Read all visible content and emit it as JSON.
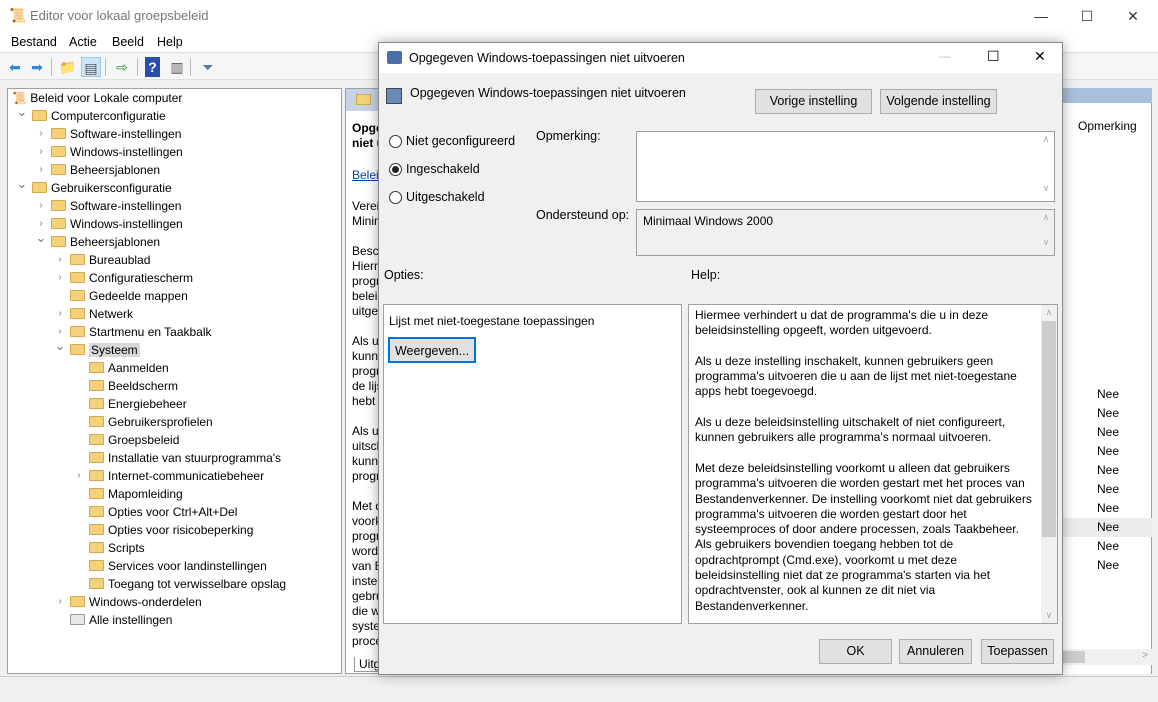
{
  "window": {
    "title": "Editor voor lokaal groepsbeleid",
    "minimize": "—",
    "maximize": "☐",
    "close": "✕"
  },
  "menu": [
    "Bestand",
    "Actie",
    "Beeld",
    "Help"
  ],
  "tree": {
    "root": "Beleid voor Lokale computer",
    "items": [
      {
        "label": "Computerconfiguratie",
        "level": 1,
        "exp": "open"
      },
      {
        "label": "Software-instellingen",
        "level": 2,
        "exp": "closed"
      },
      {
        "label": "Windows-instellingen",
        "level": 2,
        "exp": "closed"
      },
      {
        "label": "Beheersjablonen",
        "level": 2,
        "exp": "closed"
      },
      {
        "label": "Gebruikersconfiguratie",
        "level": 1,
        "exp": "open"
      },
      {
        "label": "Software-instellingen",
        "level": 2,
        "exp": "closed"
      },
      {
        "label": "Windows-instellingen",
        "level": 2,
        "exp": "closed"
      },
      {
        "label": "Beheersjablonen",
        "level": 2,
        "exp": "open"
      },
      {
        "label": "Bureaublad",
        "level": 3,
        "exp": "closed"
      },
      {
        "label": "Configuratiescherm",
        "level": 3,
        "exp": "closed"
      },
      {
        "label": "Gedeelde mappen",
        "level": 3,
        "exp": "none"
      },
      {
        "label": "Netwerk",
        "level": 3,
        "exp": "closed"
      },
      {
        "label": "Startmenu en Taakbalk",
        "level": 3,
        "exp": "closed"
      },
      {
        "label": "Systeem",
        "level": 3,
        "exp": "open",
        "selected": true
      },
      {
        "label": "Aanmelden",
        "level": 4,
        "exp": "none"
      },
      {
        "label": "Beeldscherm",
        "level": 4,
        "exp": "none"
      },
      {
        "label": "Energiebeheer",
        "level": 4,
        "exp": "none"
      },
      {
        "label": "Gebruikersprofielen",
        "level": 4,
        "exp": "none"
      },
      {
        "label": "Groepsbeleid",
        "level": 4,
        "exp": "none"
      },
      {
        "label": "Installatie van stuurprogramma's",
        "level": 4,
        "exp": "none"
      },
      {
        "label": "Internet-communicatiebeheer",
        "level": 4,
        "exp": "closed"
      },
      {
        "label": "Mapomleiding",
        "level": 4,
        "exp": "none"
      },
      {
        "label": "Opties voor Ctrl+Alt+Del",
        "level": 4,
        "exp": "none"
      },
      {
        "label": "Opties voor risicobeperking",
        "level": 4,
        "exp": "none"
      },
      {
        "label": "Scripts",
        "level": 4,
        "exp": "none"
      },
      {
        "label": "Services voor landinstellingen",
        "level": 4,
        "exp": "none"
      },
      {
        "label": "Toegang tot verwisselbare opslag",
        "level": 4,
        "exp": "none"
      },
      {
        "label": "Windows-onderdelen",
        "level": 3,
        "exp": "closed"
      },
      {
        "label": "Alle instellingen",
        "level": 3,
        "exp": "none",
        "special": true
      }
    ]
  },
  "middle": {
    "title": [
      "Opge",
      "niet u"
    ],
    "link": "Beleid",
    "lines": [
      "Vereis",
      "Minin",
      "",
      "Besch",
      "Hiern",
      "progr",
      "beleid",
      "uitge",
      "",
      "Als u",
      "kunn",
      "progr",
      "de lijs",
      "hebt",
      "",
      "Als u",
      "uitscl",
      "kunn",
      "progr",
      "",
      "Met d",
      "voork",
      "progr",
      "word",
      "van B",
      "instel",
      "gebru",
      "die w",
      "syste",
      "proce"
    ],
    "tab": "Uitg"
  },
  "right": {
    "column": "Opmerking",
    "values": [
      "Nee",
      "Nee",
      "Nee",
      "Nee",
      "Nee",
      "Nee",
      "Nee",
      "Nee",
      "Nee",
      "Nee"
    ]
  },
  "dialog": {
    "title": "Opgegeven Windows-toepassingen niet uitvoeren",
    "heading": "Opgegeven Windows-toepassingen niet uitvoeren",
    "prev": "Vorige instelling",
    "next": "Volgende instelling",
    "radios": [
      {
        "label": "Niet geconfigureerd",
        "checked": false
      },
      {
        "label": "Ingeschakeld",
        "checked": true
      },
      {
        "label": "Uitgeschakeld",
        "checked": false
      }
    ],
    "comment_label": "Opmerking:",
    "comment_value": "",
    "supported_label": "Ondersteund op:",
    "supported_value": "Minimaal Windows 2000",
    "options_label": "Opties:",
    "help_label": "Help:",
    "options_list_label": "Lijst met niet-toegestane toepassingen",
    "show_button": "Weergeven...",
    "help_text": "Hiermee verhindert u dat de programma's die u in deze beleidsinstelling opgeeft, worden uitgevoerd.\n\nAls u deze instelling inschakelt, kunnen gebruikers geen programma's uitvoeren die u aan de lijst met niet-toegestane apps hebt toegevoegd.\n\nAls u deze beleidsinstelling uitschakelt of niet configureert, kunnen gebruikers alle programma's normaal uitvoeren.\n\nMet deze beleidsinstelling voorkomt u alleen dat gebruikers programma's uitvoeren die worden gestart met het proces van Bestandenverkenner. De instelling voorkomt niet dat gebruikers programma's uitvoeren die worden gestart door het systeemproces of door andere processen, zoals Taakbeheer.  Als gebruikers bovendien toegang hebben tot de opdrachtprompt (Cmd.exe), voorkomt u met deze beleidsinstelling niet dat ze programma's starten via het opdrachtvenster, ook al kunnen ze dit niet via Bestandenverkenner.\n\nOpmerking: programma's die niet van Microsoft zijn met een",
    "ok": "OK",
    "cancel": "Annuleren",
    "apply": "Toepassen"
  }
}
